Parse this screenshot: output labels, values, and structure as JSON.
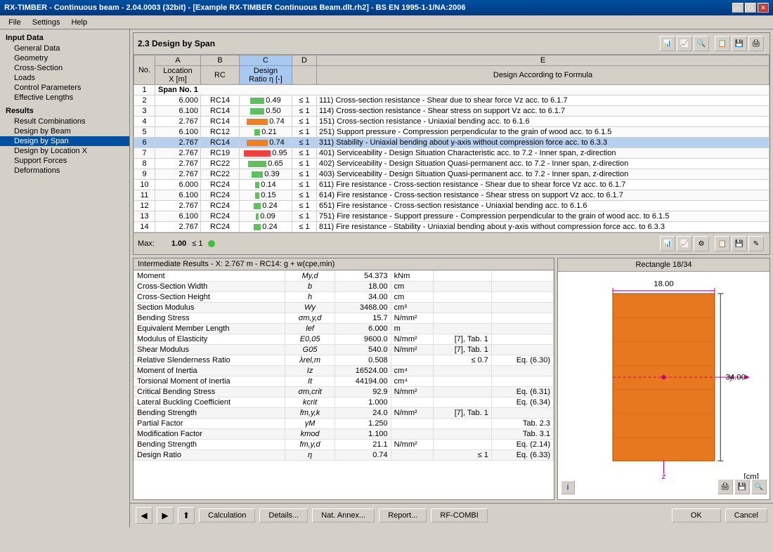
{
  "titlebar": {
    "text": "RX-TIMBER - Continuous beam - 2.04.0003 (32bit) - [Example RX-TIMBER Continuous Beam.dlt.rh2] - BS EN 1995-1-1/NA:2006",
    "min": "─",
    "max": "□",
    "close": "✕"
  },
  "menu": {
    "items": [
      "File",
      "Settings",
      "Help"
    ]
  },
  "sidebar": {
    "sections": [
      {
        "label": "Input Data",
        "items": [
          {
            "id": "general-data",
            "label": "General Data",
            "active": false
          },
          {
            "id": "geometry",
            "label": "Geometry",
            "active": false
          },
          {
            "id": "cross-section",
            "label": "Cross-Section",
            "active": false
          },
          {
            "id": "loads",
            "label": "Loads",
            "active": false
          },
          {
            "id": "control-parameters",
            "label": "Control Parameters",
            "active": false
          },
          {
            "id": "effective-lengths",
            "label": "Effective Lengths",
            "active": false
          }
        ]
      },
      {
        "label": "Results",
        "items": [
          {
            "id": "result-combinations",
            "label": "Result Combinations",
            "active": false
          },
          {
            "id": "design-by-beam",
            "label": "Design by Beam",
            "active": false
          },
          {
            "id": "design-by-span",
            "label": "Design by Span",
            "active": true
          },
          {
            "id": "design-by-location",
            "label": "Design by Location X",
            "active": false
          },
          {
            "id": "support-forces",
            "label": "Support Forces",
            "active": false
          },
          {
            "id": "deformations",
            "label": "Deformations",
            "active": false
          }
        ]
      }
    ]
  },
  "main_section_title": "2.3 Design by Span",
  "table_headers": {
    "no": "No.",
    "col_a": "A",
    "col_b": "B",
    "col_c": "C",
    "col_d": "D",
    "col_e": "E",
    "location": "Location",
    "x_m": "X [m]",
    "rc": "RC",
    "design": "Design",
    "ratio": "Ratio η [-]",
    "formula": "Design According to Formula"
  },
  "table_rows": [
    {
      "no": "1",
      "x": "",
      "rc": "",
      "ratio": "",
      "le": "",
      "formula": "Span No. 1",
      "span_header": true
    },
    {
      "no": "2",
      "x": "6.000",
      "rc": "RC14",
      "ratio": "0.49",
      "le": "≤ 1",
      "formula": "111) Cross-section resistance - Shear due to shear force Vz acc. to 6.1.7",
      "color": ""
    },
    {
      "no": "3",
      "x": "6.100",
      "rc": "RC14",
      "ratio": "0.50",
      "le": "≤ 1",
      "formula": "114) Cross-section resistance - Shear stress on support Vz acc. to 6.1.7",
      "color": ""
    },
    {
      "no": "4",
      "x": "2.767",
      "rc": "RC14",
      "ratio": "0.74",
      "le": "≤ 1",
      "formula": "151) Cross-section resistance - Uniaxial bending acc. to 6.1.6",
      "color": ""
    },
    {
      "no": "5",
      "x": "6.100",
      "rc": "RC12",
      "ratio": "0.21",
      "le": "≤ 1",
      "formula": "251) Support pressure - Compression perpendicular to the grain of wood acc. to 6.1.5",
      "color": ""
    },
    {
      "no": "6",
      "x": "2.767",
      "rc": "RC14",
      "ratio": "0.74",
      "le": "≤ 1",
      "formula": "311) Stability - Uniaxial bending about y-axis without compression force acc. to 6.3.3",
      "color": "highlight"
    },
    {
      "no": "7",
      "x": "2.767",
      "rc": "RC19",
      "ratio": "0.95",
      "le": "≤ 1",
      "formula": "401) Serviceability - Design Situation Characteristic acc. to 7.2 - Inner span, z-direction",
      "color": ""
    },
    {
      "no": "8",
      "x": "2.767",
      "rc": "RC22",
      "ratio": "0.65",
      "le": "≤ 1",
      "formula": "402) Serviceability - Design Situation Quasi-permanent acc. to 7.2 - Inner span, z-direction",
      "color": ""
    },
    {
      "no": "9",
      "x": "2.767",
      "rc": "RC22",
      "ratio": "0.39",
      "le": "≤ 1",
      "formula": "403) Serviceability - Design Situation Quasi-permanent acc. to 7.2 - Inner span, z-direction",
      "color": ""
    },
    {
      "no": "10",
      "x": "6.000",
      "rc": "RC24",
      "ratio": "0.14",
      "le": "≤ 1",
      "formula": "611) Fire resistance - Cross-section resistance - Shear due to shear force Vz acc. to 6.1.7",
      "color": ""
    },
    {
      "no": "11",
      "x": "6.100",
      "rc": "RC24",
      "ratio": "0.15",
      "le": "≤ 1",
      "formula": "614) Fire resistance - Cross-section resistance - Shear stress on support Vz acc. to 6.1.7",
      "color": ""
    },
    {
      "no": "12",
      "x": "2.767",
      "rc": "RC24",
      "ratio": "0.24",
      "le": "≤ 1",
      "formula": "651) Fire resistance - Cross-section resistance - Uniaxial bending acc. to 6.1.6",
      "color": ""
    },
    {
      "no": "13",
      "x": "6.100",
      "rc": "RC24",
      "ratio": "0.09",
      "le": "≤ 1",
      "formula": "751) Fire resistance - Support pressure - Compression perpendicular to the grain of wood acc. to 6.1.5",
      "color": ""
    },
    {
      "no": "14",
      "x": "2.767",
      "rc": "RC24",
      "ratio": "0.24",
      "le": "≤ 1",
      "formula": "811) Fire resistance - Stability - Uniaxial bending about y-axis without compression force acc. to 6.3.3",
      "color": ""
    }
  ],
  "max_row": {
    "label": "Max:",
    "value": "1.00",
    "le": "≤ 1"
  },
  "intermediate_title": "Intermediate Results  -  X: 2.767 m  -  RC14: g + w(cpe,min)",
  "intermediate_rows": [
    {
      "name": "Moment",
      "symbol": "My,d",
      "value": "54.373",
      "unit": "kNm",
      "ref": "",
      "extra": ""
    },
    {
      "name": "Cross-Section Width",
      "symbol": "b",
      "value": "18.00",
      "unit": "cm",
      "ref": "",
      "extra": ""
    },
    {
      "name": "Cross-Section Height",
      "symbol": "h",
      "value": "34.00",
      "unit": "cm",
      "ref": "",
      "extra": ""
    },
    {
      "name": "Section Modulus",
      "symbol": "Wy",
      "value": "3468.00",
      "unit": "cm³",
      "ref": "",
      "extra": ""
    },
    {
      "name": "Bending Stress",
      "symbol": "σm,y,d",
      "value": "15.7",
      "unit": "N/mm²",
      "ref": "",
      "extra": ""
    },
    {
      "name": "Equivalent Member Length",
      "symbol": "lef",
      "value": "6.000",
      "unit": "m",
      "ref": "",
      "extra": ""
    },
    {
      "name": "Modulus of Elasticity",
      "symbol": "E0,05",
      "value": "9600.0",
      "unit": "N/mm²",
      "ref": "[7], Tab. 1",
      "extra": ""
    },
    {
      "name": "Shear Modulus",
      "symbol": "G05",
      "value": "540.0",
      "unit": "N/mm²",
      "ref": "[7], Tab. 1",
      "extra": ""
    },
    {
      "name": "Relative Slenderness Ratio",
      "symbol": "λrel,m",
      "value": "0.508",
      "unit": "",
      "ref": "≤ 0.7",
      "extra": "Eq. (6.30)"
    },
    {
      "name": "Moment of Inertia",
      "symbol": "Iz",
      "value": "16524.00",
      "unit": "cm⁴",
      "ref": "",
      "extra": ""
    },
    {
      "name": "Torsional Moment of Inertia",
      "symbol": "It",
      "value": "44194.00",
      "unit": "cm⁴",
      "ref": "",
      "extra": ""
    },
    {
      "name": "Critical Bending Stress",
      "symbol": "σm,crit",
      "value": "92.9",
      "unit": "N/mm²",
      "ref": "",
      "extra": "Eq. (6.31)"
    },
    {
      "name": "Lateral Buckling Coefficient",
      "symbol": "kcrit",
      "value": "1.000",
      "unit": "",
      "ref": "",
      "extra": "Eq. (6.34)"
    },
    {
      "name": "Bending Strength",
      "symbol": "fm,y,k",
      "value": "24.0",
      "unit": "N/mm²",
      "ref": "[7], Tab. 1",
      "extra": ""
    },
    {
      "name": "Partial Factor",
      "symbol": "γM",
      "value": "1.250",
      "unit": "",
      "ref": "",
      "extra": "Tab. 2.3"
    },
    {
      "name": "Modification Factor",
      "symbol": "kmod",
      "value": "1.100",
      "unit": "",
      "ref": "",
      "extra": "Tab. 3.1"
    },
    {
      "name": "Bending Strength",
      "symbol": "fm,y,d",
      "value": "21.1",
      "unit": "N/mm²",
      "ref": "",
      "extra": "Eq. (2.14)"
    },
    {
      "name": "Design Ratio",
      "symbol": "η",
      "value": "0.74",
      "unit": "",
      "ref": "≤ 1",
      "extra": "Eq. (6.33)"
    }
  ],
  "diagram": {
    "title": "Rectangle 18/34",
    "width_label": "18.00",
    "height_label": "34.00",
    "unit": "[cm]"
  },
  "buttons": {
    "calculation": "Calculation",
    "details": "Details...",
    "nat_annex": "Nat. Annex...",
    "report": "Report...",
    "rf_combi": "RF-COMBI",
    "ok": "OK",
    "cancel": "Cancel"
  }
}
